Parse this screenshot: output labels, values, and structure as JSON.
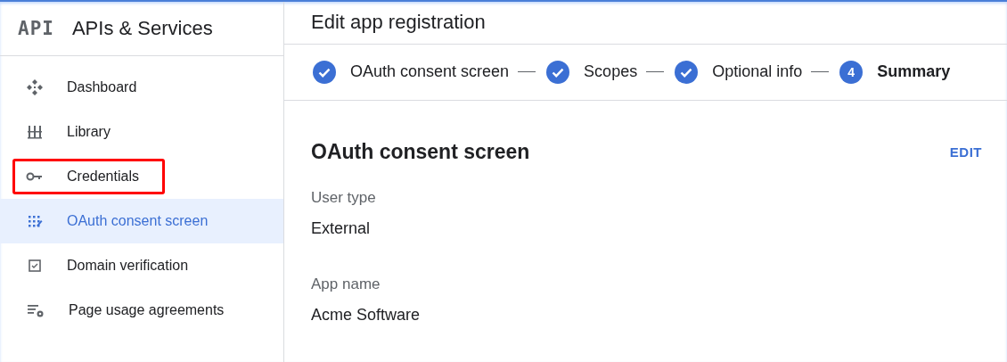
{
  "header": {
    "logo": "API",
    "title": "APIs & Services",
    "page_title": "Edit app registration"
  },
  "sidebar": {
    "items": [
      {
        "label": "Dashboard",
        "selected": false,
        "highlighted": false
      },
      {
        "label": "Library",
        "selected": false,
        "highlighted": false
      },
      {
        "label": "Credentials",
        "selected": false,
        "highlighted": true
      },
      {
        "label": "OAuth consent screen",
        "selected": true,
        "highlighted": false
      },
      {
        "label": "Domain verification",
        "selected": false,
        "highlighted": false
      },
      {
        "label": "Page usage agreements",
        "selected": false,
        "highlighted": false
      }
    ]
  },
  "stepper": {
    "steps": [
      {
        "label": "OAuth consent screen",
        "done": true,
        "selected": false
      },
      {
        "label": "Scopes",
        "done": true,
        "selected": false
      },
      {
        "label": "Optional info",
        "done": true,
        "selected": false
      },
      {
        "label": "Summary",
        "done": false,
        "number": "4",
        "selected": true
      }
    ]
  },
  "section": {
    "title": "OAuth consent screen",
    "action": "EDIT",
    "fields": [
      {
        "label": "User type",
        "value": "External"
      },
      {
        "label": "App name",
        "value": "Acme Software"
      }
    ]
  }
}
